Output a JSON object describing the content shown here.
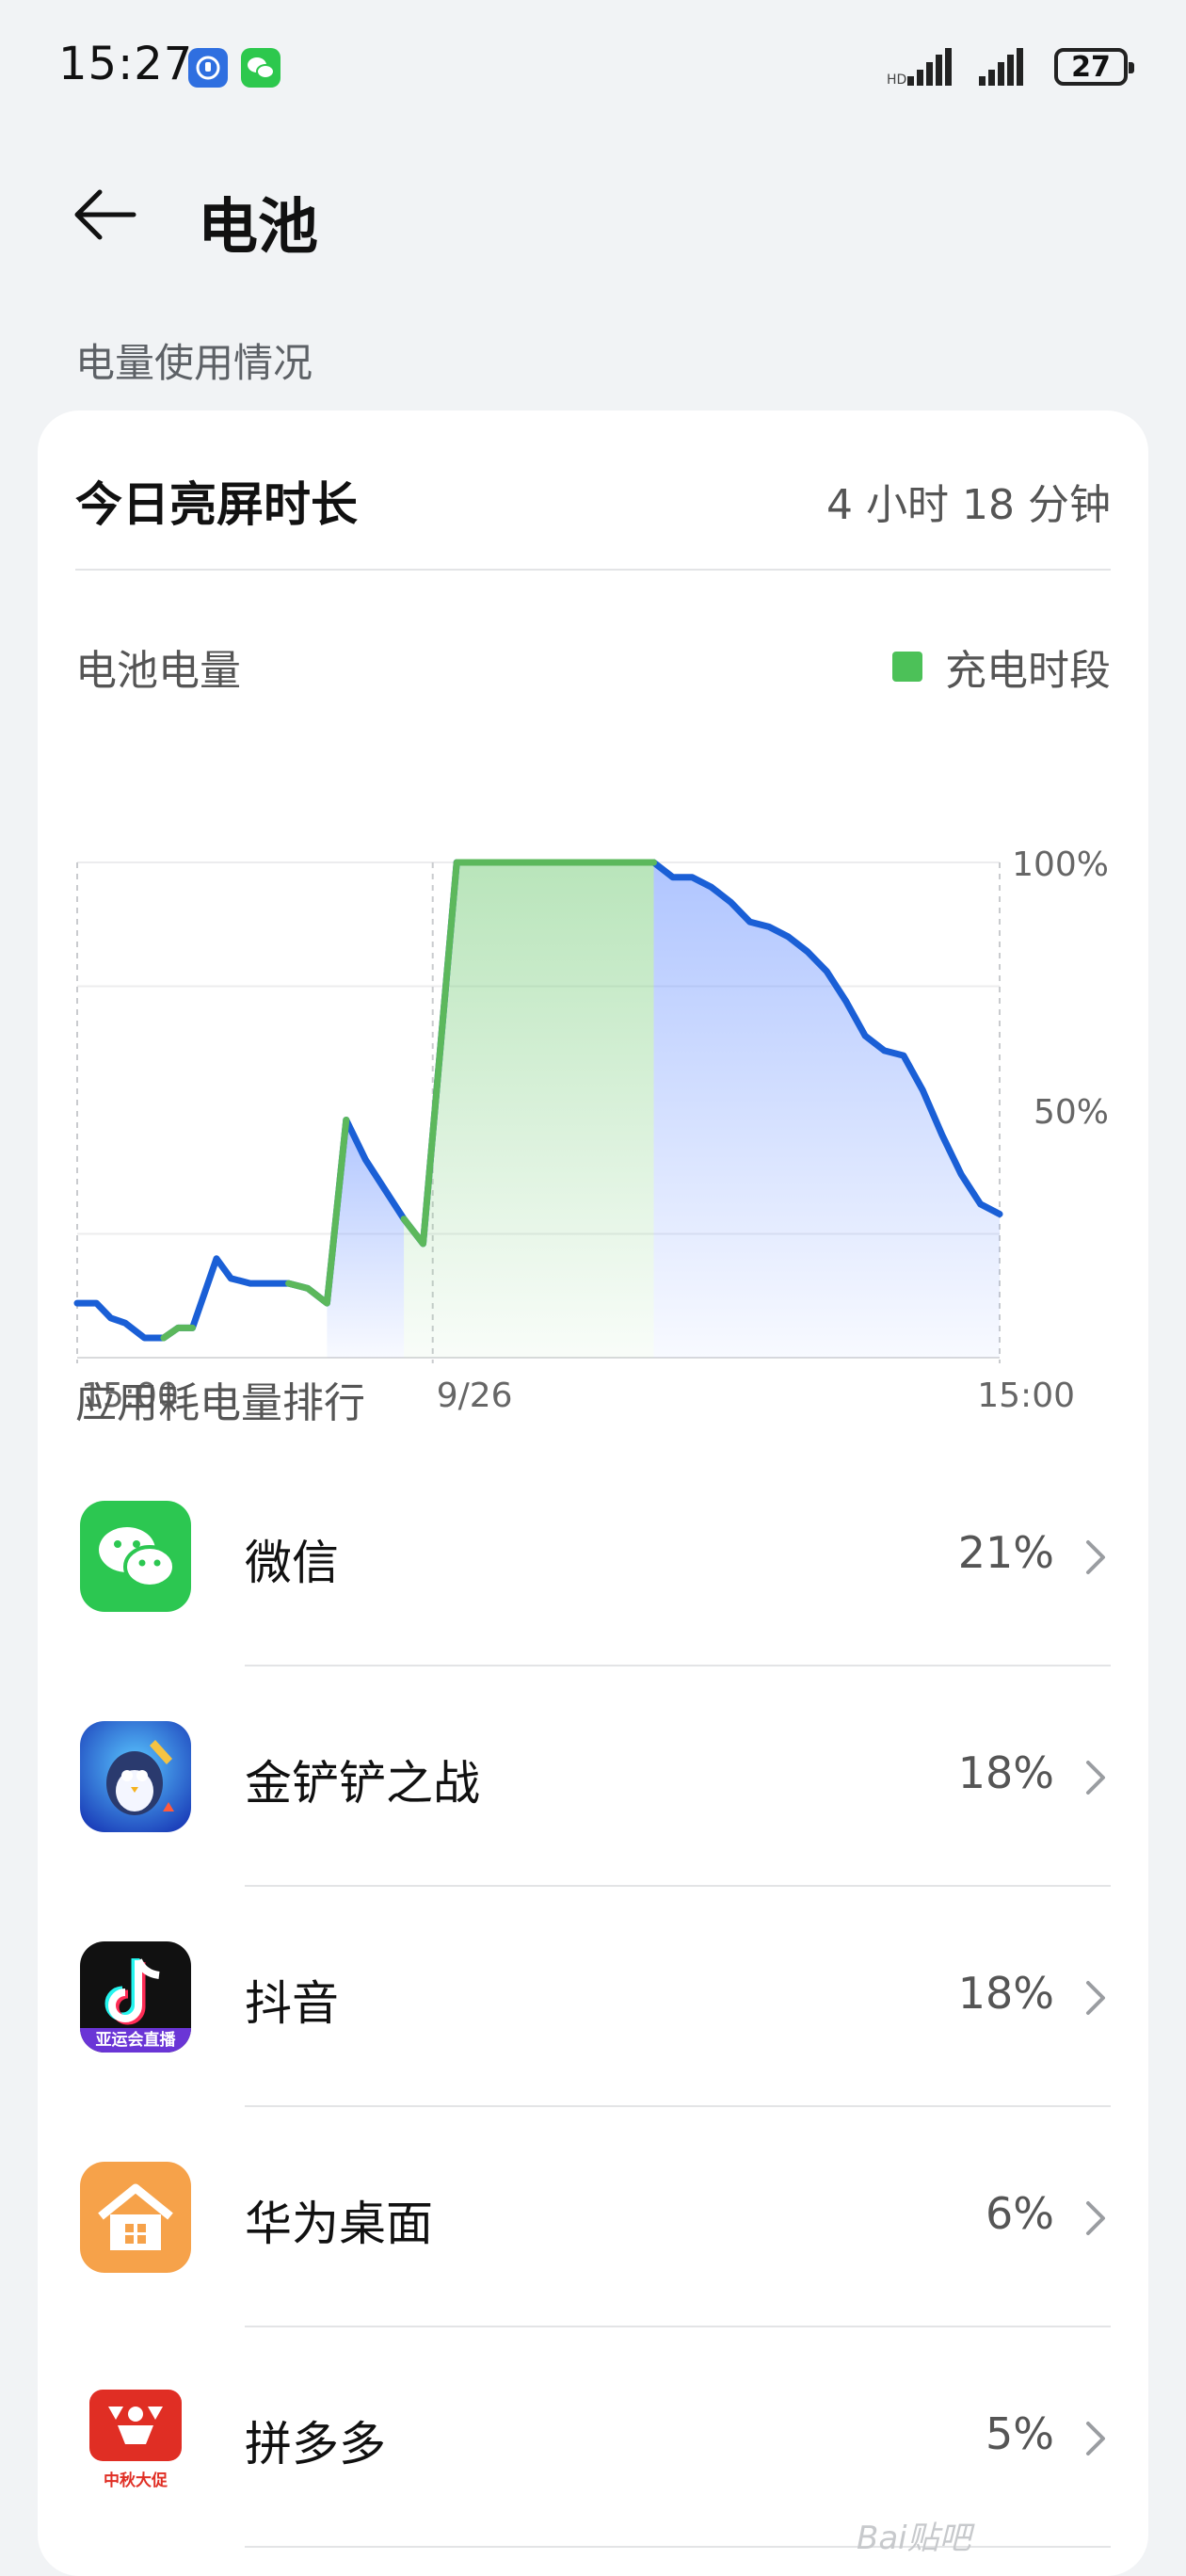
{
  "status_bar": {
    "time": "15:27",
    "battery_level": "27",
    "notifications": [
      "app-notification-icon",
      "wechat-notification-icon"
    ]
  },
  "header": {
    "title": "电池"
  },
  "section": {
    "usage_label": "电量使用情况"
  },
  "screen_time": {
    "label": "今日亮屏时长",
    "value": "4 小时 18 分钟"
  },
  "battery_chart": {
    "label": "电池电量",
    "legend": "充电时段",
    "colors": {
      "charging": "#5cb85c",
      "discharging": "#1a5fd6"
    }
  },
  "chart_data": {
    "type": "line",
    "ylim": [
      0,
      100
    ],
    "y_ticks": [
      "100%",
      "50%"
    ],
    "x_ticks": [
      "15:00",
      "9/26",
      "15:00"
    ],
    "series": [
      {
        "values": [
          [
            0,
            11
          ],
          [
            2,
            11
          ],
          [
            3.5,
            8
          ],
          [
            5,
            7
          ],
          [
            7,
            4
          ],
          [
            9,
            4
          ],
          [
            10.5,
            6
          ],
          [
            12,
            6
          ],
          [
            14.5,
            20
          ],
          [
            16,
            16
          ],
          [
            18,
            15
          ],
          [
            20,
            15
          ],
          [
            22,
            15
          ],
          [
            24,
            14
          ],
          [
            26,
            11
          ],
          [
            28,
            48
          ],
          [
            30,
            40
          ],
          [
            32,
            34
          ],
          [
            34,
            28
          ],
          [
            36,
            23
          ],
          [
            39.5,
            100
          ],
          [
            43,
            100
          ],
          [
            45,
            100
          ],
          [
            50,
            100
          ],
          [
            55,
            100
          ],
          [
            58,
            100
          ],
          [
            60,
            100
          ],
          [
            62,
            97
          ],
          [
            64,
            97
          ],
          [
            66,
            95
          ],
          [
            68,
            92
          ],
          [
            70,
            88
          ],
          [
            72,
            87
          ],
          [
            74,
            85
          ],
          [
            76,
            82
          ],
          [
            78,
            78
          ],
          [
            80,
            72
          ],
          [
            82,
            65
          ],
          [
            84,
            62
          ],
          [
            86,
            61
          ],
          [
            88,
            54
          ],
          [
            90,
            45
          ],
          [
            92,
            37
          ],
          [
            94,
            31
          ],
          [
            96,
            29
          ]
        ]
      }
    ]
  },
  "ranking": {
    "title": "应用耗电量排行",
    "apps": [
      {
        "name": "微信",
        "percent": "21%",
        "icon": "wechat-app-icon"
      },
      {
        "name": "金铲铲之战",
        "percent": "18%",
        "icon": "golden-spatula-game-icon"
      },
      {
        "name": "抖音",
        "percent": "18%",
        "icon": "douyin-app-icon",
        "icon_text": "亚运会直播"
      },
      {
        "name": "华为桌面",
        "percent": "6%",
        "icon": "huawei-home-icon"
      },
      {
        "name": "拼多多",
        "percent": "5%",
        "icon": "pinduoduo-app-icon",
        "icon_text": "中秋大促"
      }
    ]
  },
  "watermark": "Bai贴吧"
}
